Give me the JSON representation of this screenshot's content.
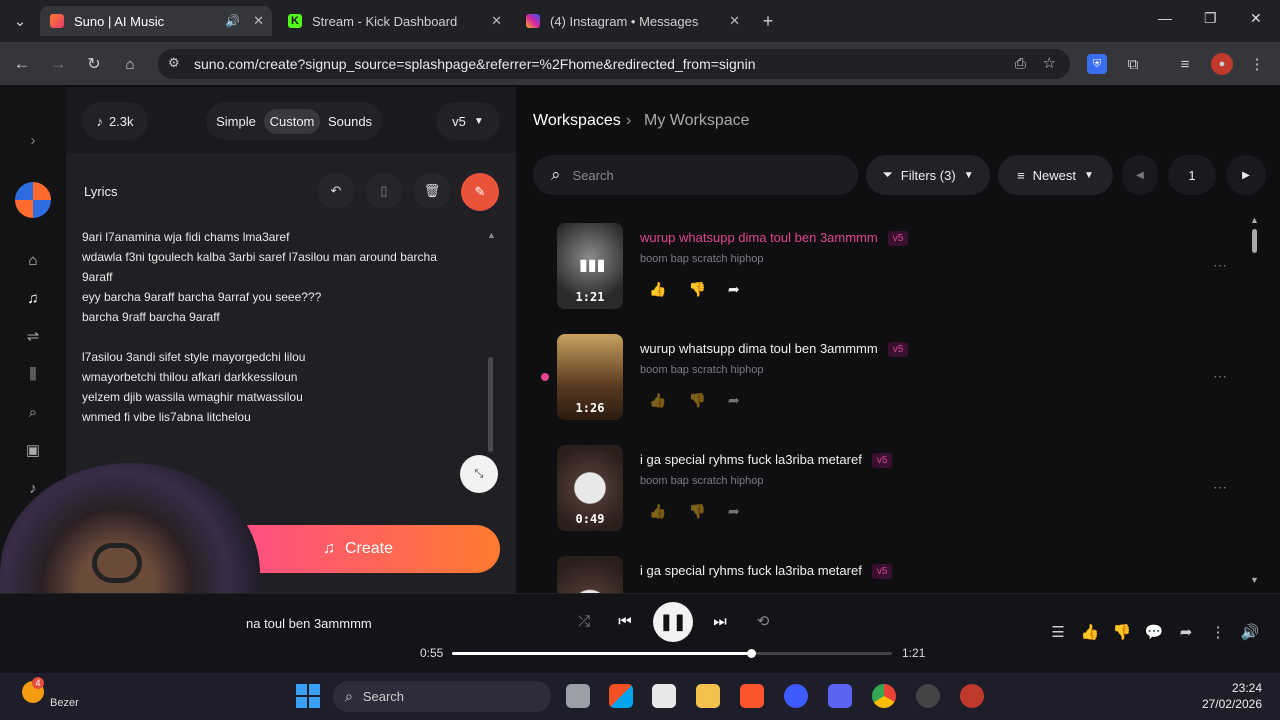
{
  "browser": {
    "tabs": [
      {
        "title": "Suno | AI Music",
        "active": true
      },
      {
        "title": "Stream - Kick Dashboard",
        "active": false
      },
      {
        "title": "(4) Instagram • Messages",
        "active": false
      }
    ],
    "url": "suno.com/create?signup_source=splashpage&referrer=%2Fhome&redirected_from=signin"
  },
  "left": {
    "credits": "2.3k",
    "modes": [
      "Simple",
      "Custom",
      "Sounds"
    ],
    "active_mode": "Custom",
    "model": "v5",
    "lyrics_label": "Lyrics",
    "lyrics": [
      "9ari l7anamina wja fidi chams lma3aref",
      "wdawla f3ni tgoulech kalba 3arbi saref l7asilou man around barcha",
      "9araff",
      "eyy barcha 9araff barcha 9arraf you seee???",
      "barcha 9raff barcha 9araff",
      "",
      "l7asilou 3andi sifet style mayorgedchi lilou",
      "wmayorbetchi thilou afkari darkkessiloun",
      "yelzem djib wassila wmaghir matwassilou",
      "wnmed fi vibe lis7abna litchelou"
    ],
    "create_label": "Create"
  },
  "right": {
    "breadcrumb_root": "Workspaces",
    "breadcrumb_current": "My Workspace",
    "search_placeholder": "Search",
    "filters_label": "Filters (3)",
    "sort_label": "Newest",
    "page_number": "1",
    "songs": [
      {
        "title": "wurup whatsupp dima toul ben 3ammmm",
        "tags": "boom bap scratch hiphop",
        "duration": "1:21",
        "badge": "v5",
        "playing": true
      },
      {
        "title": "wurup whatsupp dima toul ben 3ammmm",
        "tags": "boom bap scratch hiphop",
        "duration": "1:26",
        "badge": "v5",
        "playing": false
      },
      {
        "title": "i ga special ryhms fuck la3riba metaref",
        "tags": "boom bap scratch hiphop",
        "duration": "0:49",
        "badge": "v5",
        "playing": false
      },
      {
        "title": "i ga special ryhms fuck la3riba metaref",
        "tags": "",
        "duration": "",
        "badge": "v5",
        "playing": false
      }
    ]
  },
  "player": {
    "now_playing": "na toul ben 3ammmm",
    "elapsed": "0:55",
    "total": "1:21",
    "progress": 0.68
  },
  "taskbar": {
    "search_placeholder": "Search",
    "time": "23:24",
    "date": "27/02/2026",
    "weather_label": "Bezer",
    "notification_count": "4"
  },
  "colors": {
    "accent_pink": "#d9448d",
    "create_gradient_start": "#ff4a8d",
    "create_gradient_end": "#ff7b2e",
    "magic_button": "#e8533a"
  }
}
